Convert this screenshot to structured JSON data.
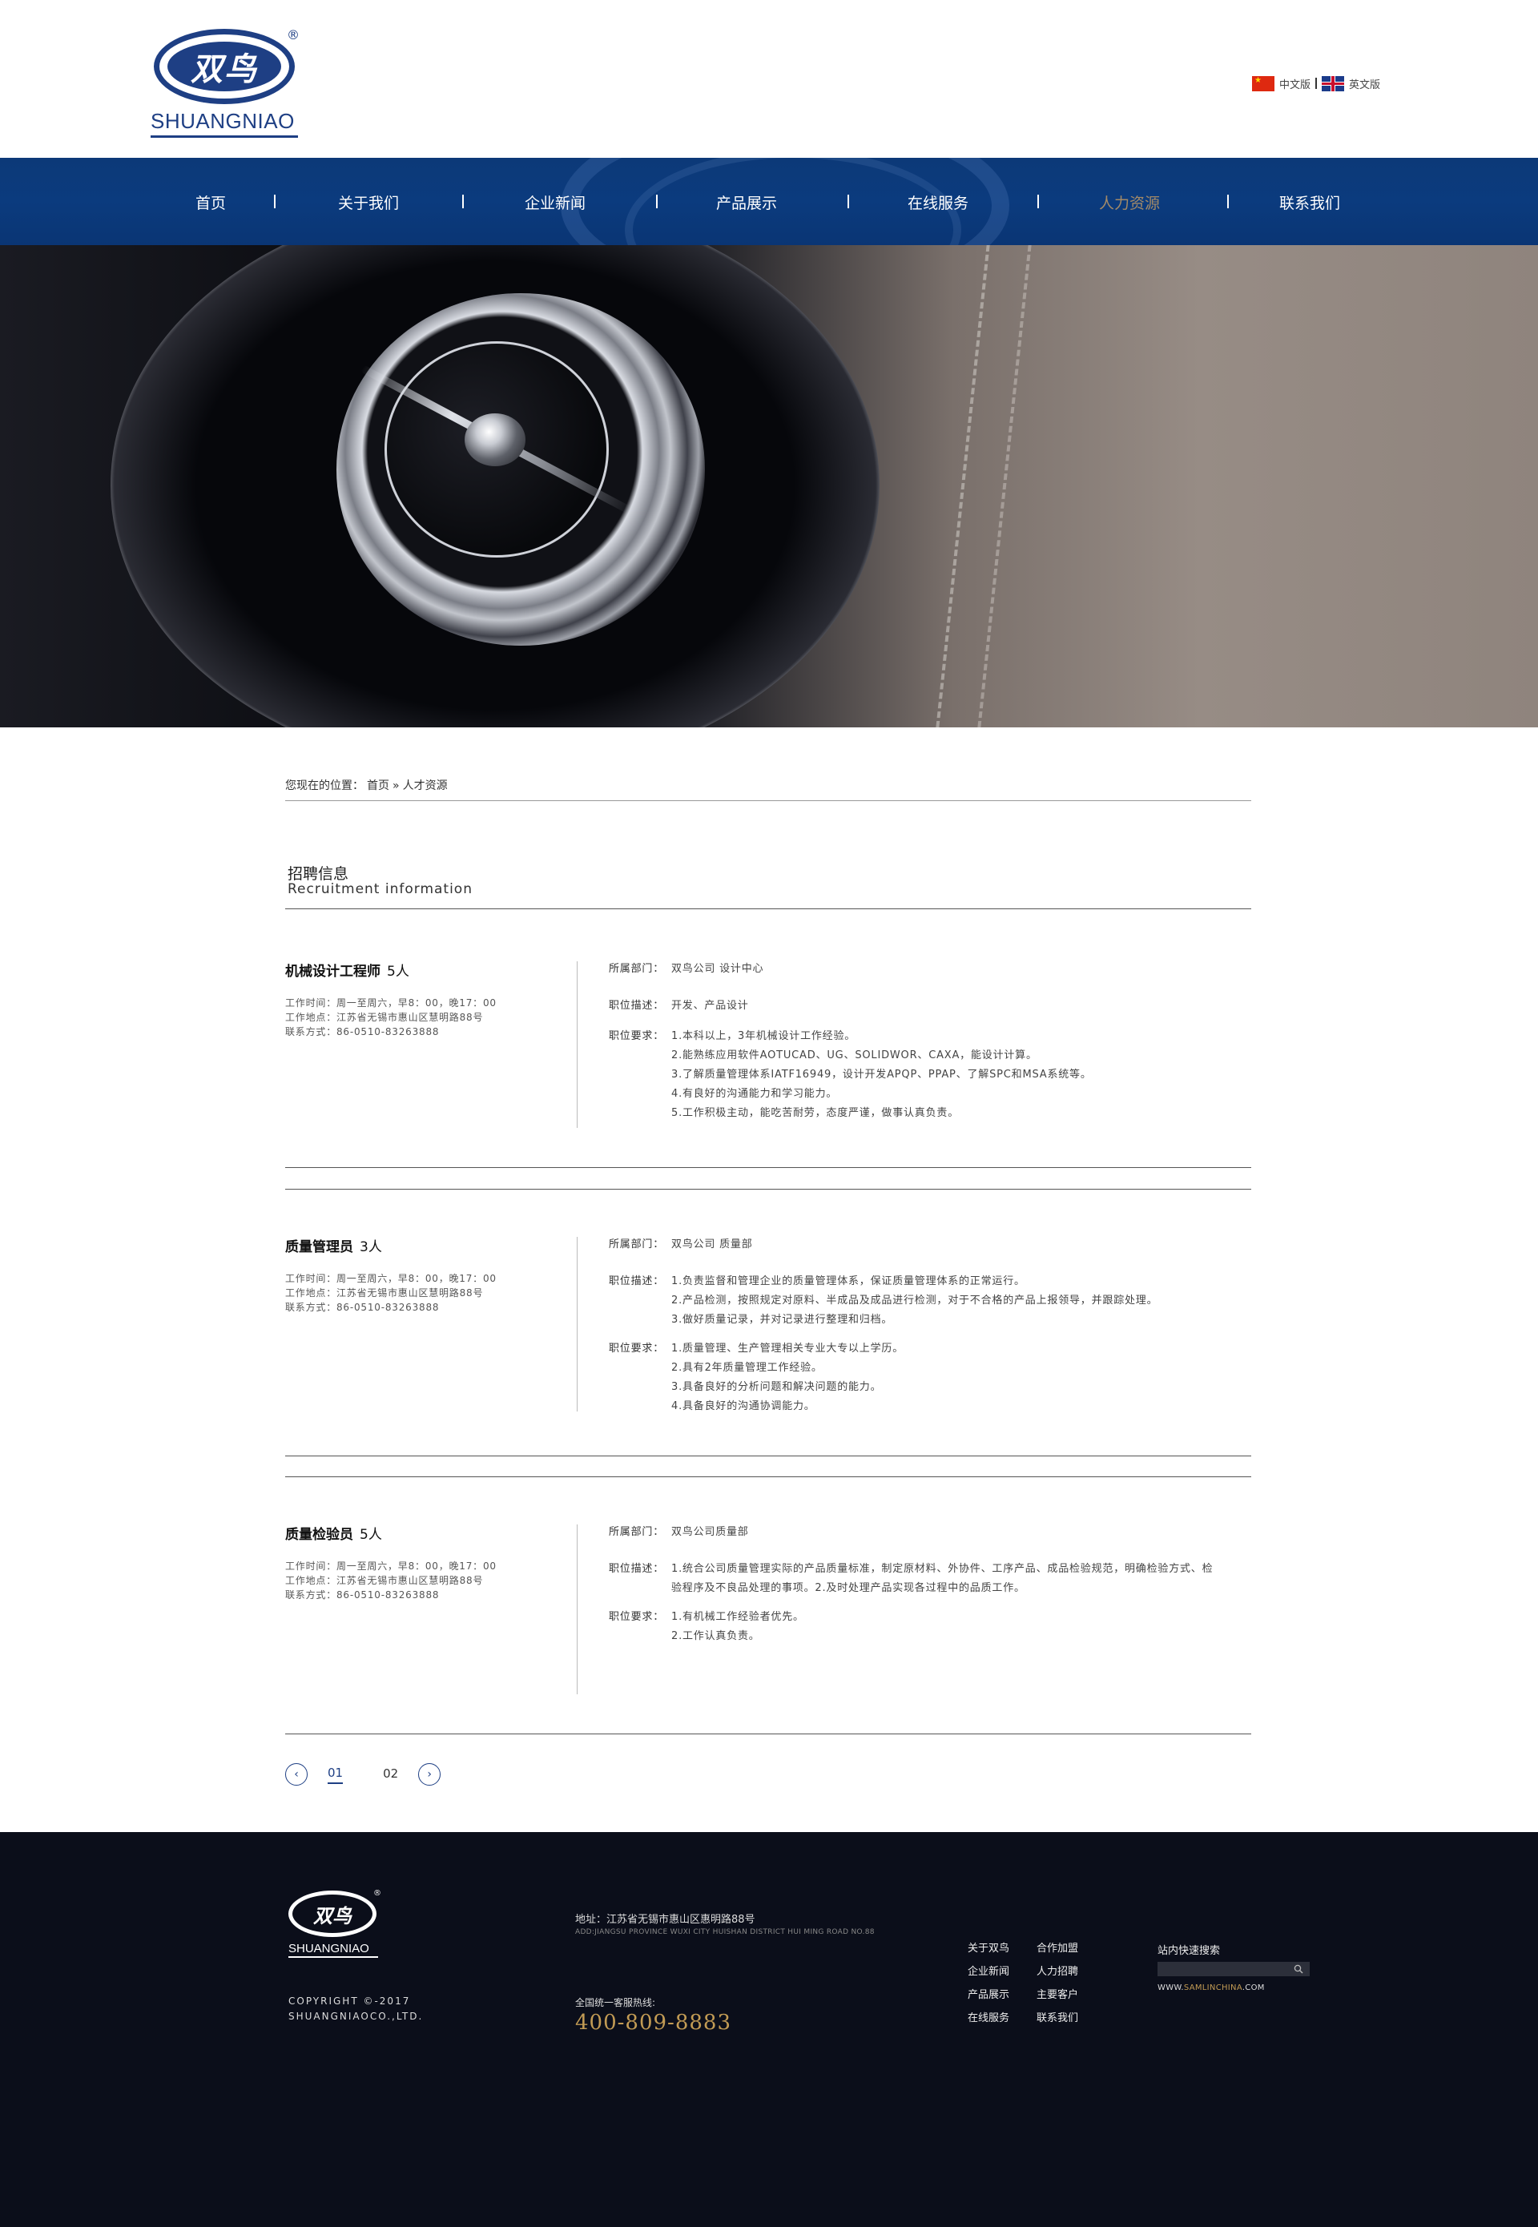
{
  "header": {
    "logo_cn": "双鸟",
    "logo_en": "SHUANGNIAO",
    "logo_reg": "®",
    "lang_cn": "中文版",
    "lang_en": "英文版"
  },
  "nav": {
    "items": [
      {
        "label": "首页"
      },
      {
        "label": "关于我们"
      },
      {
        "label": "企业新闻"
      },
      {
        "label": "产品展示"
      },
      {
        "label": "在线服务"
      },
      {
        "label": "人力资源"
      },
      {
        "label": "联系我们"
      }
    ],
    "active_index": 5,
    "active_color": "#a38a68"
  },
  "breadcrumb": {
    "prefix": "您现在的位置：",
    "home": "首页",
    "sep": "»",
    "current": "人才资源"
  },
  "section": {
    "title": "招聘信息",
    "subtitle": "Recruitment information"
  },
  "jobs": [
    {
      "title": "机械设计工程师",
      "count": "5人",
      "meta": [
        "工作时间：周一至周六，早8：00，晚17：00",
        "工作地点：江苏省无锡市惠山区慧明路88号",
        "联系方式：86-0510-83263888"
      ],
      "dept_label": "所属部门：",
      "dept": "双鸟公司 设计中心",
      "desc_label": "职位描述：",
      "desc": [
        "开发、产品设计"
      ],
      "req_label": "职位要求：",
      "req": [
        "1.本科以上，3年机械设计工作经验。",
        "2.能熟练应用软件AOTUCAD、UG、SOLIDWOR、CAXA，能设计计算。",
        "3.了解质量管理体系IATF16949，设计开发APQP、PPAP、了解SPC和MSA系统等。",
        "4.有良好的沟通能力和学习能力。",
        "5.工作积极主动，能吃苦耐劳，态度严谨，做事认真负责。"
      ]
    },
    {
      "title": "质量管理员",
      "count": "3人",
      "meta": [
        "工作时间：周一至周六，早8：00，晚17：00",
        "工作地点：江苏省无锡市惠山区慧明路88号",
        "联系方式：86-0510-83263888"
      ],
      "dept_label": "所属部门：",
      "dept": "双鸟公司 质量部",
      "desc_label": "职位描述：",
      "desc": [
        "1.负责监督和管理企业的质量管理体系，保证质量管理体系的正常运行。",
        "2.产品检测，按照规定对原料、半成品及成品进行检测，对于不合格的产品上报领导，并跟踪处理。",
        "3.做好质量记录，并对记录进行整理和归档。"
      ],
      "req_label": "职位要求：",
      "req": [
        "1.质量管理、生产管理相关专业大专以上学历。",
        "2.具有2年质量管理工作经验。",
        "3.具备良好的分析问题和解决问题的能力。",
        "4.具备良好的沟通协调能力。"
      ]
    },
    {
      "title": "质量检验员",
      "count": "5人",
      "meta": [
        "工作时间：周一至周六，早8：00，晚17：00",
        "工作地点：江苏省无锡市惠山区慧明路88号",
        "联系方式：86-0510-83263888"
      ],
      "dept_label": "所属部门：",
      "dept": "双鸟公司质量部",
      "desc_label": "职位描述：",
      "desc": [
        "1.统合公司质量管理实际的产品质量标准，制定原材料、外协件、工序产品、成品检验规范，明确检验方式、检",
        "验程序及不良品处理的事项。2.及时处理产品实现各过程中的品质工作。"
      ],
      "req_label": "职位要求：",
      "req": [
        "1.有机械工作经验者优先。",
        "2.工作认真负责。"
      ]
    }
  ],
  "pager": {
    "prev": "‹",
    "next": "›",
    "pages": [
      "01",
      "02"
    ],
    "active": 0
  },
  "footer": {
    "logo_cn": "双鸟",
    "logo_en": "SHUANGNIAO",
    "logo_reg": "®",
    "copyright_1": "COPYRIGHT ©-2017",
    "copyright_2": "SHUANGNIAOCO.,LTD.",
    "address": "地址：江苏省无锡市惠山区惠明路88号",
    "address_en": "ADD:JIANGSU PROVINCE WUXI CITY HUISHAN DISTRICT HUI MING ROAD NO.88",
    "hotline_label": "全国统一客服热线:",
    "hotline": "400-809-8883",
    "links": [
      "关于双鸟",
      "合作加盟",
      "企业新闻",
      "人力招聘",
      "产品展示",
      "主要客户",
      "在线服务",
      "联系我们"
    ],
    "search_label": "站内快速搜索",
    "search_icon": "search-icon",
    "site_prefix": "WWW.",
    "site_hl": "SAMLINCHINA",
    "site_suffix": ".COM"
  },
  "colors": {
    "brand_blue": "#1e3f84",
    "nav_bg": "#0b3b7e",
    "footer_bg": "#0b0e1a",
    "gold": "#c29b54"
  }
}
